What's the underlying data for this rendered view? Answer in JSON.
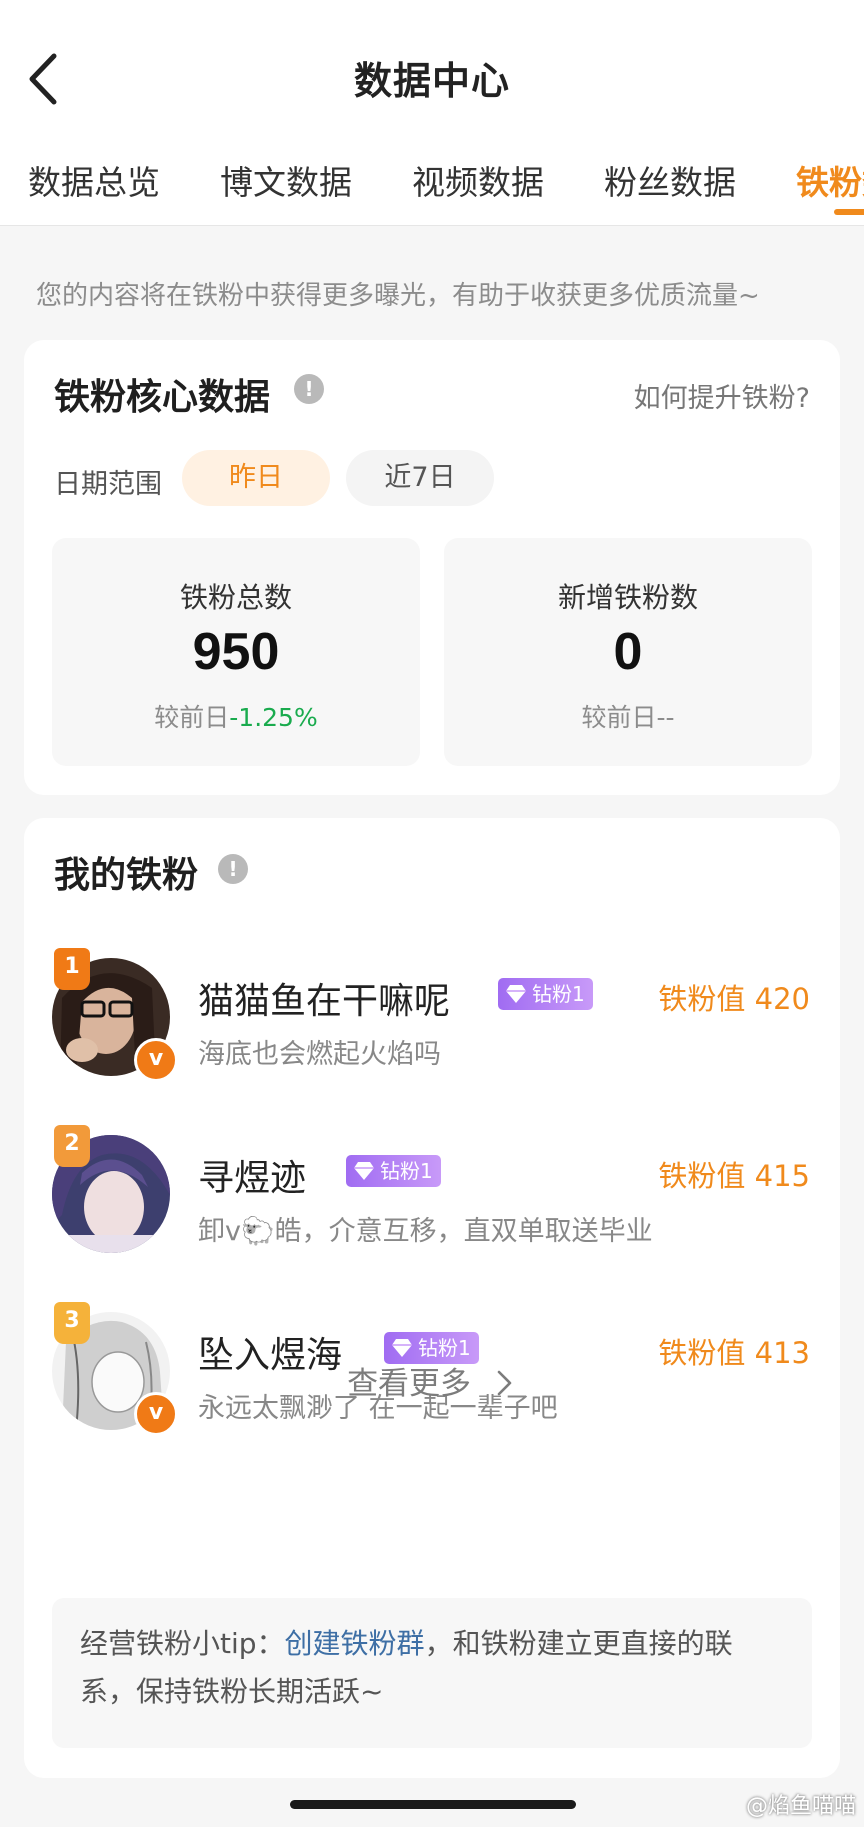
{
  "header": {
    "title": "数据中心",
    "back_icon": "back-chevron-icon"
  },
  "tabs": [
    {
      "label": "数据总览",
      "active": false
    },
    {
      "label": "博文数据",
      "active": false
    },
    {
      "label": "视频数据",
      "active": false
    },
    {
      "label": "粉丝数据",
      "active": false
    },
    {
      "label": "铁粉数据",
      "active": true
    }
  ],
  "notice": "您的内容将在铁粉中获得更多曝光，有助于收获更多优质流量~",
  "core": {
    "title": "铁粉核心数据",
    "info_icon": "!",
    "help_link": "如何提升铁粉?",
    "date_label": "日期范围",
    "date_options": [
      "昨日",
      "近7日"
    ],
    "selected_option": "昨日",
    "stats": [
      {
        "label": "铁粉总数",
        "value": "950",
        "compare_prefix": "较前日",
        "compare_value": "-1.25%"
      },
      {
        "label": "新增铁粉数",
        "value": "0",
        "compare_prefix": "较前日",
        "compare_value": "--"
      }
    ]
  },
  "fans": {
    "title": "我的铁粉",
    "info_icon": "!",
    "list": [
      {
        "rank": "1",
        "name": "猫猫鱼在干嘛呢",
        "badge": "钻粉1",
        "value": "铁粉值 420",
        "desc": "海底也会燃起火焰吗",
        "verified": true,
        "verified_mark": "v"
      },
      {
        "rank": "2",
        "name": "寻煜迹",
        "badge": "钻粉1",
        "value": "铁粉值 415",
        "desc": "卸v🐑皓，介意互移，直双单取送毕业",
        "verified": false
      },
      {
        "rank": "3",
        "name": "坠入煜海",
        "badge": "钻粉1",
        "value": "铁粉值 413",
        "desc": "永远太飘渺了 在一起一辈子吧",
        "verified": true,
        "verified_mark": "v"
      }
    ],
    "more": "查看更多",
    "tip_prefix": "经营铁粉小tip：",
    "tip_link": "创建铁粉群",
    "tip_suffix": "，和铁粉建立更直接的联系，保持铁粉长期活跃~"
  },
  "watermark": "@焰鱼喵喵",
  "colors": {
    "accent": "#f08a1c",
    "positive": "#1aab4e",
    "link": "#3e6fa5",
    "badge": "#a06cf2"
  }
}
